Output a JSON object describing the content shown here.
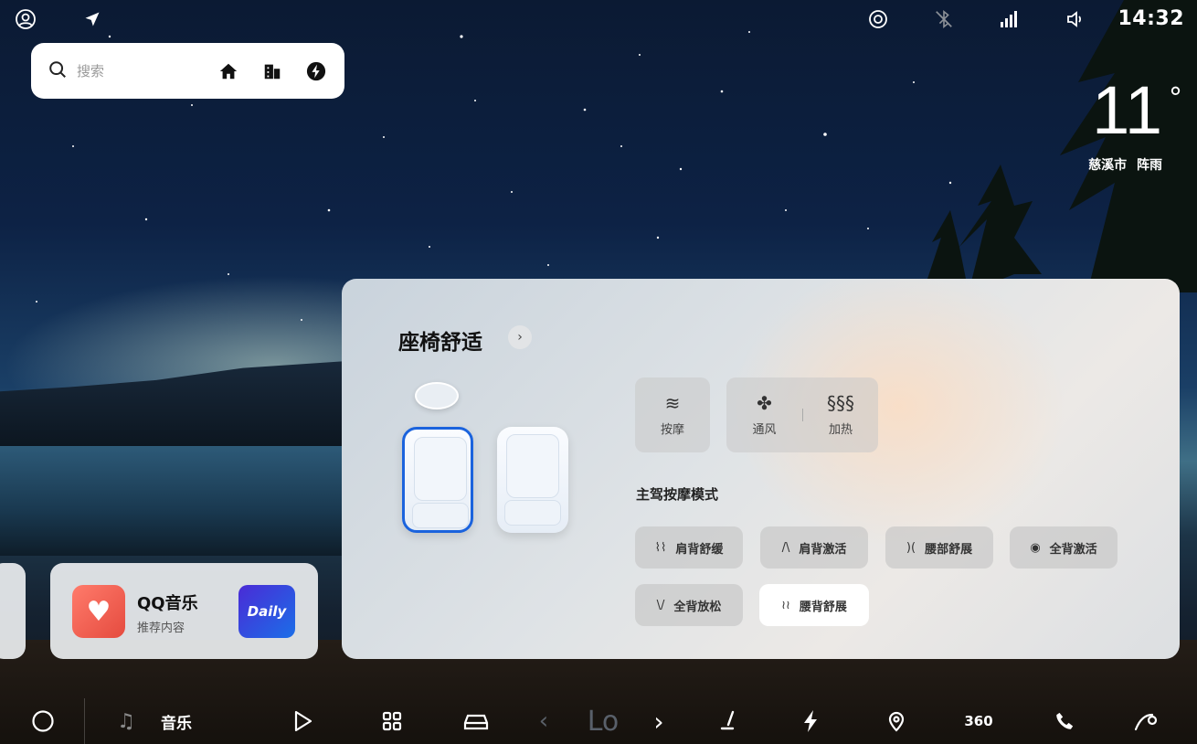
{
  "status_bar": {
    "time": "14:32",
    "icons": [
      "user-icon",
      "location-arrow-icon",
      "target-icon",
      "bluetooth-off-icon",
      "signal-icon",
      "volume-icon"
    ]
  },
  "search": {
    "placeholder": "搜索"
  },
  "weather": {
    "temperature": "11",
    "degree_symbol": "°",
    "location": "慈溪市",
    "condition": "阵雨"
  },
  "panel": {
    "title": "座椅舒适",
    "feature_tiles": [
      {
        "label": "按摩",
        "icon": "massage-icon"
      },
      {
        "label": "通风",
        "icon": "fan-icon"
      },
      {
        "label": "加热",
        "icon": "heat-icon"
      }
    ],
    "mode_section_title": "主驾按摩模式",
    "modes": [
      {
        "label": "肩背舒缓",
        "icon": "⌇⌇",
        "active": false
      },
      {
        "label": "肩背激活",
        "icon": "/\\",
        "active": false
      },
      {
        "label": "腰部舒展",
        "icon": ")(",
        "active": false
      },
      {
        "label": "全背激活",
        "icon": "◉",
        "active": false
      },
      {
        "label": "全背放松",
        "icon": "\\/",
        "active": false
      },
      {
        "label": "腰背舒展",
        "icon": "≀≀",
        "active": true
      }
    ],
    "selected_seat": "driver"
  },
  "music_card": {
    "app_name": "QQ音乐",
    "subtitle": "推荐内容",
    "tile_text": "Daily"
  },
  "dock": {
    "music_label": "音乐",
    "hvac_level": "Lo",
    "climate_badge": "360"
  }
}
